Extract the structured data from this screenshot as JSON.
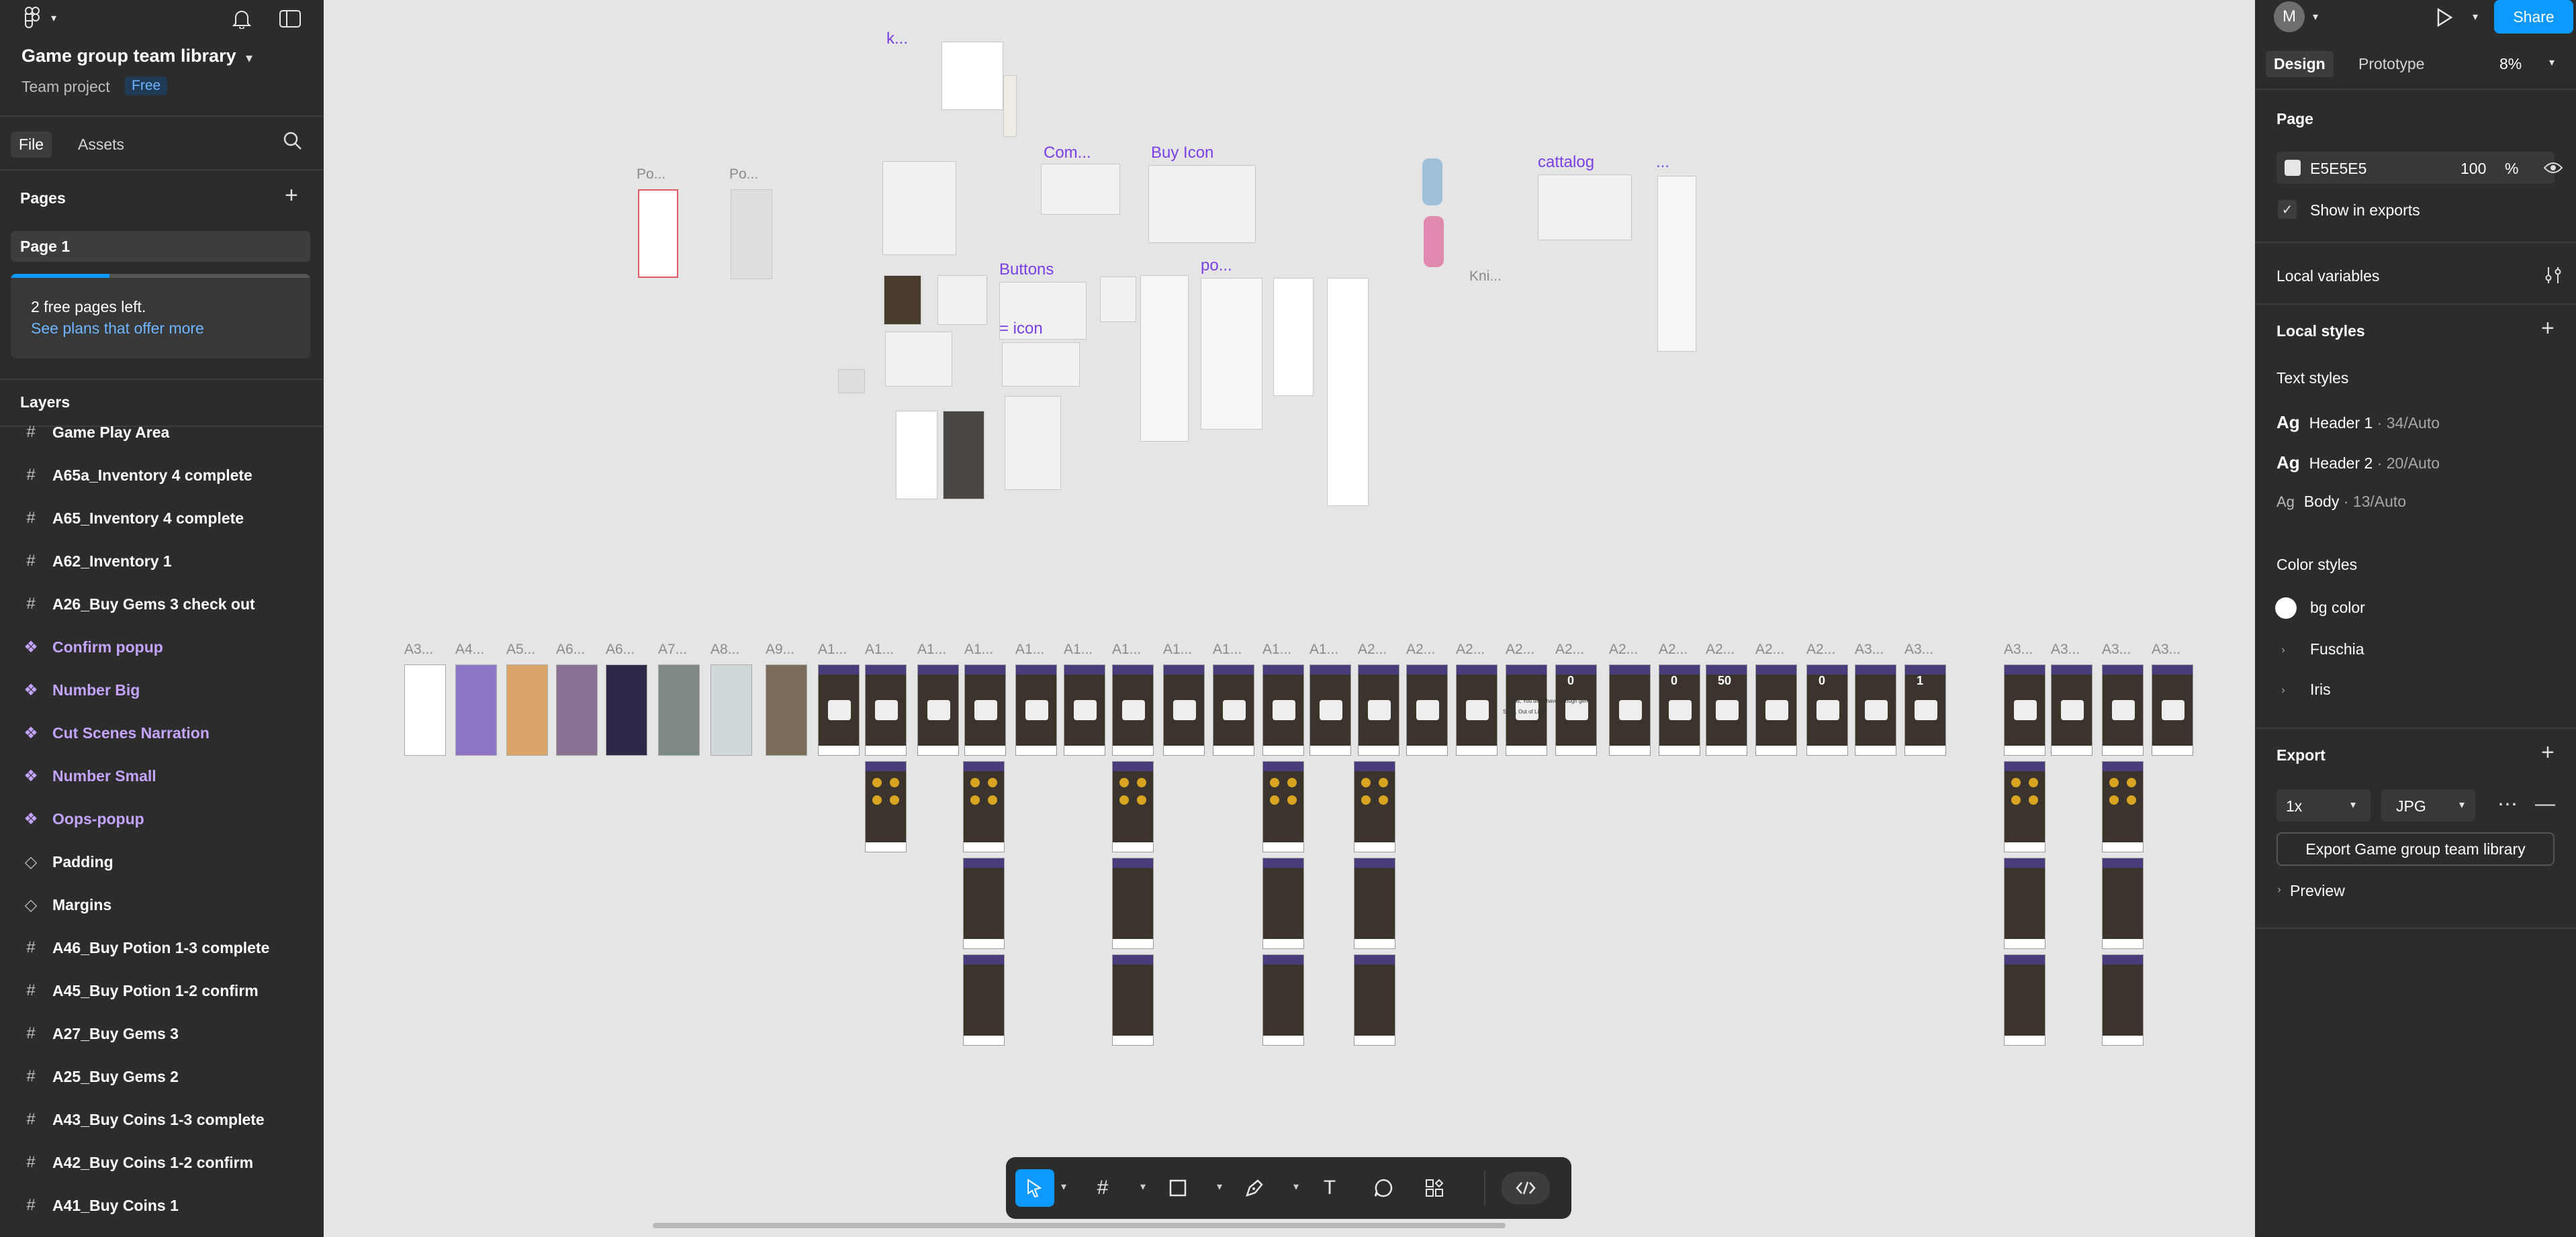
{
  "left_panel": {
    "file_title": "Game group team library",
    "project": "Team project",
    "plan_badge": "Free",
    "tabs": [
      "File",
      "Assets"
    ],
    "pages_heading": "Pages",
    "pages": [
      "Page 1"
    ],
    "quota_text": "2 free pages left.",
    "quota_link": "See plans that offer more",
    "quota_progress": 0.33,
    "layers_heading": "Layers",
    "layers": [
      {
        "label": "Game Play Area",
        "type": "frame"
      },
      {
        "label": "A65a_Inventory 4 complete",
        "type": "frame"
      },
      {
        "label": "A65_Inventory 4 complete",
        "type": "frame"
      },
      {
        "label": "A62_Inventory 1",
        "type": "frame"
      },
      {
        "label": "A26_Buy Gems 3 check out",
        "type": "frame"
      },
      {
        "label": "Confirm popup",
        "type": "component"
      },
      {
        "label": "Number Big",
        "type": "component"
      },
      {
        "label": "Cut Scenes Narration",
        "type": "component"
      },
      {
        "label": "Number Small",
        "type": "component"
      },
      {
        "label": "Oops-popup",
        "type": "component"
      },
      {
        "label": "Padding",
        "type": "variant"
      },
      {
        "label": "Margins",
        "type": "variant"
      },
      {
        "label": "A46_Buy Potion 1-3 complete",
        "type": "frame"
      },
      {
        "label": "A45_Buy Potion 1-2 confirm",
        "type": "frame"
      },
      {
        "label": "A27_Buy Gems 3",
        "type": "frame"
      },
      {
        "label": "A25_Buy Gems 2",
        "type": "frame"
      },
      {
        "label": "A43_Buy Coins 1-3 complete",
        "type": "frame"
      },
      {
        "label": "A42_Buy Coins 1-2 confirm",
        "type": "frame"
      },
      {
        "label": "A41_Buy Coins 1",
        "type": "frame"
      }
    ]
  },
  "canvas": {
    "frame_labels_top": [
      "Po...",
      "Po..."
    ],
    "component_labels": [
      "k...",
      "Com...",
      "Buy Icon",
      "Buttons",
      "= icon",
      "po...",
      "cattalog",
      "..."
    ],
    "small_labels": [
      "Kni..."
    ],
    "screen_labels": [
      "A3...",
      "A4...",
      "A5...",
      "A6...",
      "A6...",
      "A7...",
      "A8...",
      "A9...",
      "A1...",
      "A1...",
      "A1...",
      "A1...",
      "A1...",
      "A1...",
      "A1...",
      "A1...",
      "A1...",
      "A1...",
      "A1...",
      "A2...",
      "A2...",
      "A2...",
      "A2...",
      "A2...",
      "A2...",
      "A2...",
      "A2...",
      "A2...",
      "A2...",
      "A3...",
      "A3...",
      "A3...",
      "A3...",
      "A3...",
      "A3..."
    ],
    "popup_texts": [
      "Oops, You don't have enough gems",
      "Sorry, Out of Life!"
    ],
    "numbers": [
      "0",
      "0",
      "50",
      "0",
      "1"
    ]
  },
  "toolbar": {
    "tools": [
      "move-tool",
      "frame-tool",
      "rectangle-tool",
      "pen-tool",
      "text-tool",
      "comment-tool",
      "actions-tool",
      "dev-mode-toggle"
    ]
  },
  "right_panel": {
    "avatar_initial": "M",
    "share_label": "Share",
    "tabs": [
      "Design",
      "Prototype"
    ],
    "zoom": "8%",
    "page_heading": "Page",
    "bg_hex": "E5E5E5",
    "bg_opacity": "100",
    "opacity_unit": "%",
    "show_in_exports": "Show in exports",
    "local_variables": "Local variables",
    "local_styles": "Local styles",
    "text_styles_heading": "Text styles",
    "text_styles": [
      {
        "name": "Header 1",
        "meta": " · 34/Auto"
      },
      {
        "name": "Header 2",
        "meta": " · 20/Auto"
      },
      {
        "name": "Body",
        "meta": " · 13/Auto"
      }
    ],
    "color_styles_heading": "Color styles",
    "color_styles": [
      "bg color",
      "Fuschia",
      "Iris"
    ],
    "export_heading": "Export",
    "export_scale": "1x",
    "export_format": "JPG",
    "export_button": "Export Game group team library",
    "preview": "Preview"
  },
  "colors": {
    "accent": "#0d99ff",
    "panel": "#2c2c2c",
    "canvas": "#e5e5e5",
    "component": "#7b3fe4"
  }
}
